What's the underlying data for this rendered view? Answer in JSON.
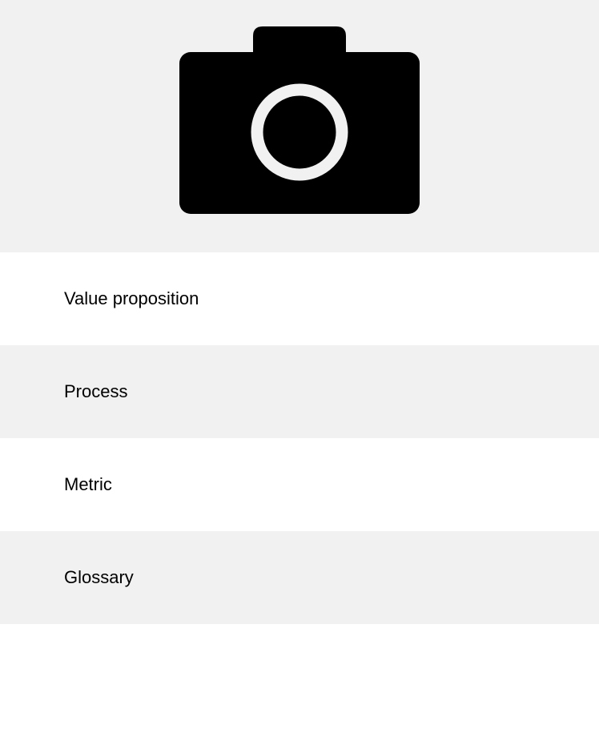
{
  "hero": {
    "icon": "camera-icon",
    "background": "#f1f1f1"
  },
  "menu": {
    "items": [
      {
        "label": "Value proposition"
      },
      {
        "label": "Process"
      },
      {
        "label": "Metric"
      },
      {
        "label": "Glossary"
      }
    ]
  }
}
